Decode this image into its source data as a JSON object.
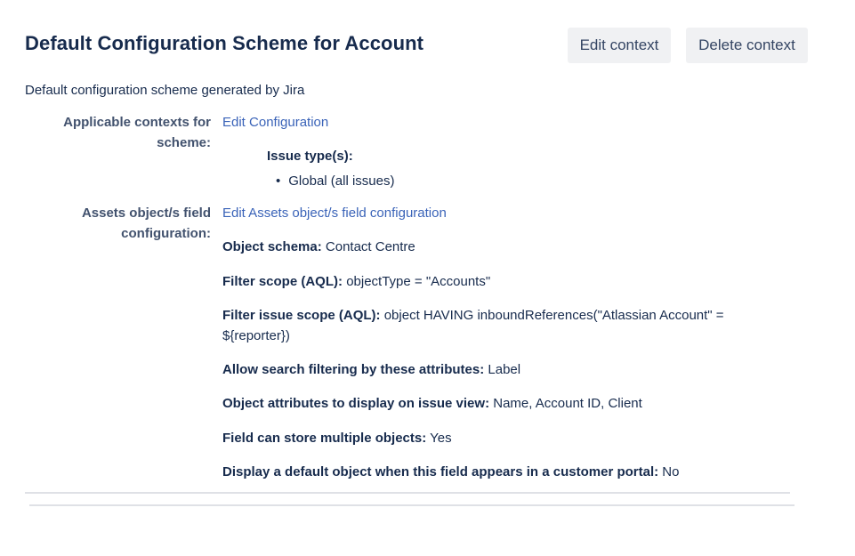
{
  "header": {
    "title": "Default Configuration Scheme for Account",
    "edit_context_label": "Edit context",
    "delete_context_label": "Delete context"
  },
  "description": "Default configuration scheme generated by Jira",
  "applicable_contexts": {
    "label": "Applicable contexts for scheme:",
    "link": "Edit Configuration",
    "issue_types_heading": "Issue type(s):",
    "issue_types": [
      "Global (all issues)"
    ]
  },
  "assets_config": {
    "label": "Assets object/s field configuration:",
    "link": "Edit Assets object/s field configuration",
    "fields": [
      {
        "key": "Object schema:",
        "value": "Contact Centre"
      },
      {
        "key": "Filter scope (AQL):",
        "value": "objectType = \"Accounts\""
      },
      {
        "key": "Filter issue scope (AQL):",
        "value": "object HAVING inboundReferences(\"Atlassian Account\" = ${reporter})"
      },
      {
        "key": "Allow search filtering by these attributes:",
        "value": "Label"
      },
      {
        "key": "Object attributes to display on issue view:",
        "value": "Name, Account ID, Client"
      },
      {
        "key": "Field can store multiple objects:",
        "value": "Yes"
      },
      {
        "key": "Display a default object when this field appears in a customer portal:",
        "value": "No"
      }
    ]
  }
}
